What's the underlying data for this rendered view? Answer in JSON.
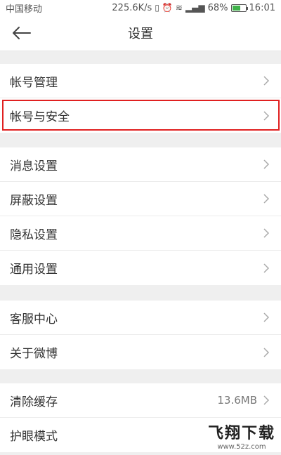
{
  "status_bar": {
    "carrier": "中国移动",
    "speed": "225.6K/s",
    "battery": "68%",
    "time": "16:01"
  },
  "nav": {
    "title": "设置"
  },
  "groups": [
    {
      "items": [
        {
          "label": "帐号管理"
        },
        {
          "label": "帐号与安全",
          "highlighted": true
        }
      ]
    },
    {
      "items": [
        {
          "label": "消息设置"
        },
        {
          "label": "屏蔽设置"
        },
        {
          "label": "隐私设置"
        },
        {
          "label": "通用设置"
        }
      ]
    },
    {
      "items": [
        {
          "label": "客服中心"
        },
        {
          "label": "关于微博"
        }
      ]
    },
    {
      "items": [
        {
          "label": "清除缓存",
          "value": "13.6MB"
        },
        {
          "label": "护眼模式"
        }
      ]
    }
  ],
  "watermark": {
    "text": "飞翔下载",
    "url": "www.52z.com"
  },
  "colors": {
    "highlight_border": "#e02020",
    "background": "#efefef"
  }
}
